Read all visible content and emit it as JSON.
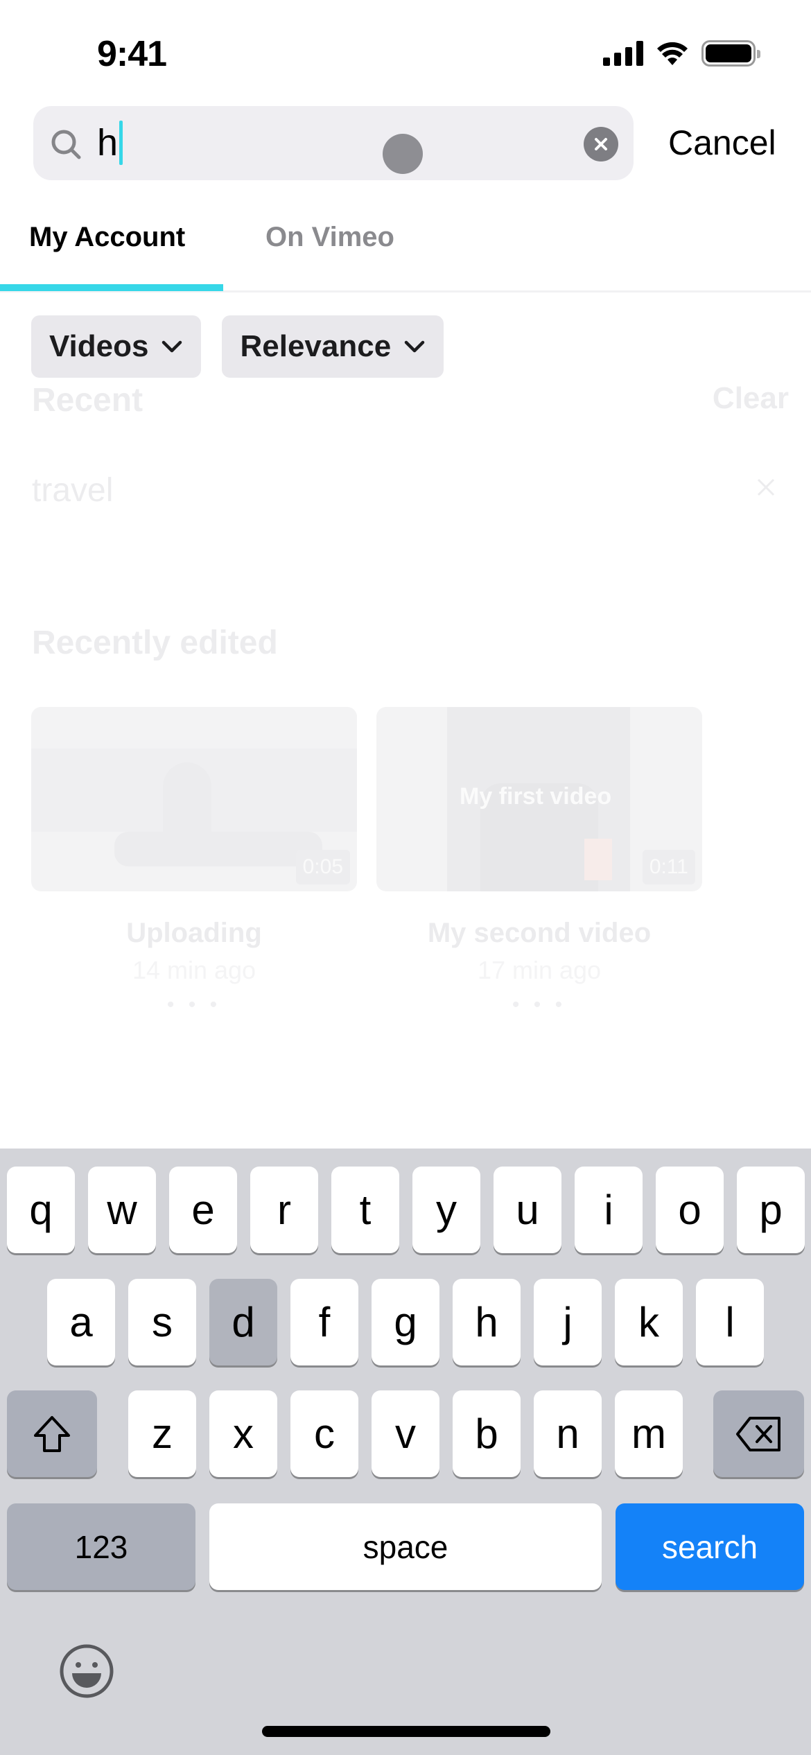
{
  "status_bar": {
    "time": "9:41",
    "icons": [
      "cellular-signal-icon",
      "wifi-icon",
      "battery-icon"
    ]
  },
  "search": {
    "value": "h",
    "clear_icon": "clear-circle-icon",
    "cancel_label": "Cancel",
    "caret_color": "#36d7e8"
  },
  "tabs": [
    {
      "label": "My Account",
      "active": true
    },
    {
      "label": "On Vimeo",
      "active": false
    }
  ],
  "accent_color": "#36d7e8",
  "filters": [
    {
      "label": "Videos",
      "icon": "chevron-down-icon"
    },
    {
      "label": "Relevance",
      "icon": "chevron-down-icon"
    }
  ],
  "recent": {
    "title": "Recent",
    "clear_label": "Clear",
    "items": [
      {
        "label": "travel",
        "remove_icon": "close-icon"
      }
    ]
  },
  "recently_edited": {
    "title": "Recently edited",
    "videos": [
      {
        "title": "Uploading",
        "time": "14 min ago",
        "duration": "0:05",
        "more": "• • •",
        "overlay_text": ""
      },
      {
        "title": "My second video",
        "time": "17 min ago",
        "duration": "0:11",
        "more": "• • •",
        "overlay_text": "My first video"
      }
    ]
  },
  "keyboard": {
    "row1": [
      "q",
      "w",
      "e",
      "r",
      "t",
      "y",
      "u",
      "i",
      "o",
      "p"
    ],
    "row2": [
      "a",
      "s",
      "d",
      "f",
      "g",
      "h",
      "j",
      "k",
      "l"
    ],
    "row3": [
      "z",
      "x",
      "c",
      "v",
      "b",
      "n",
      "m"
    ],
    "pressed_key": "d",
    "numbers_label": "123",
    "space_label": "space",
    "action_label": "search",
    "action_color": "#1482f8"
  }
}
